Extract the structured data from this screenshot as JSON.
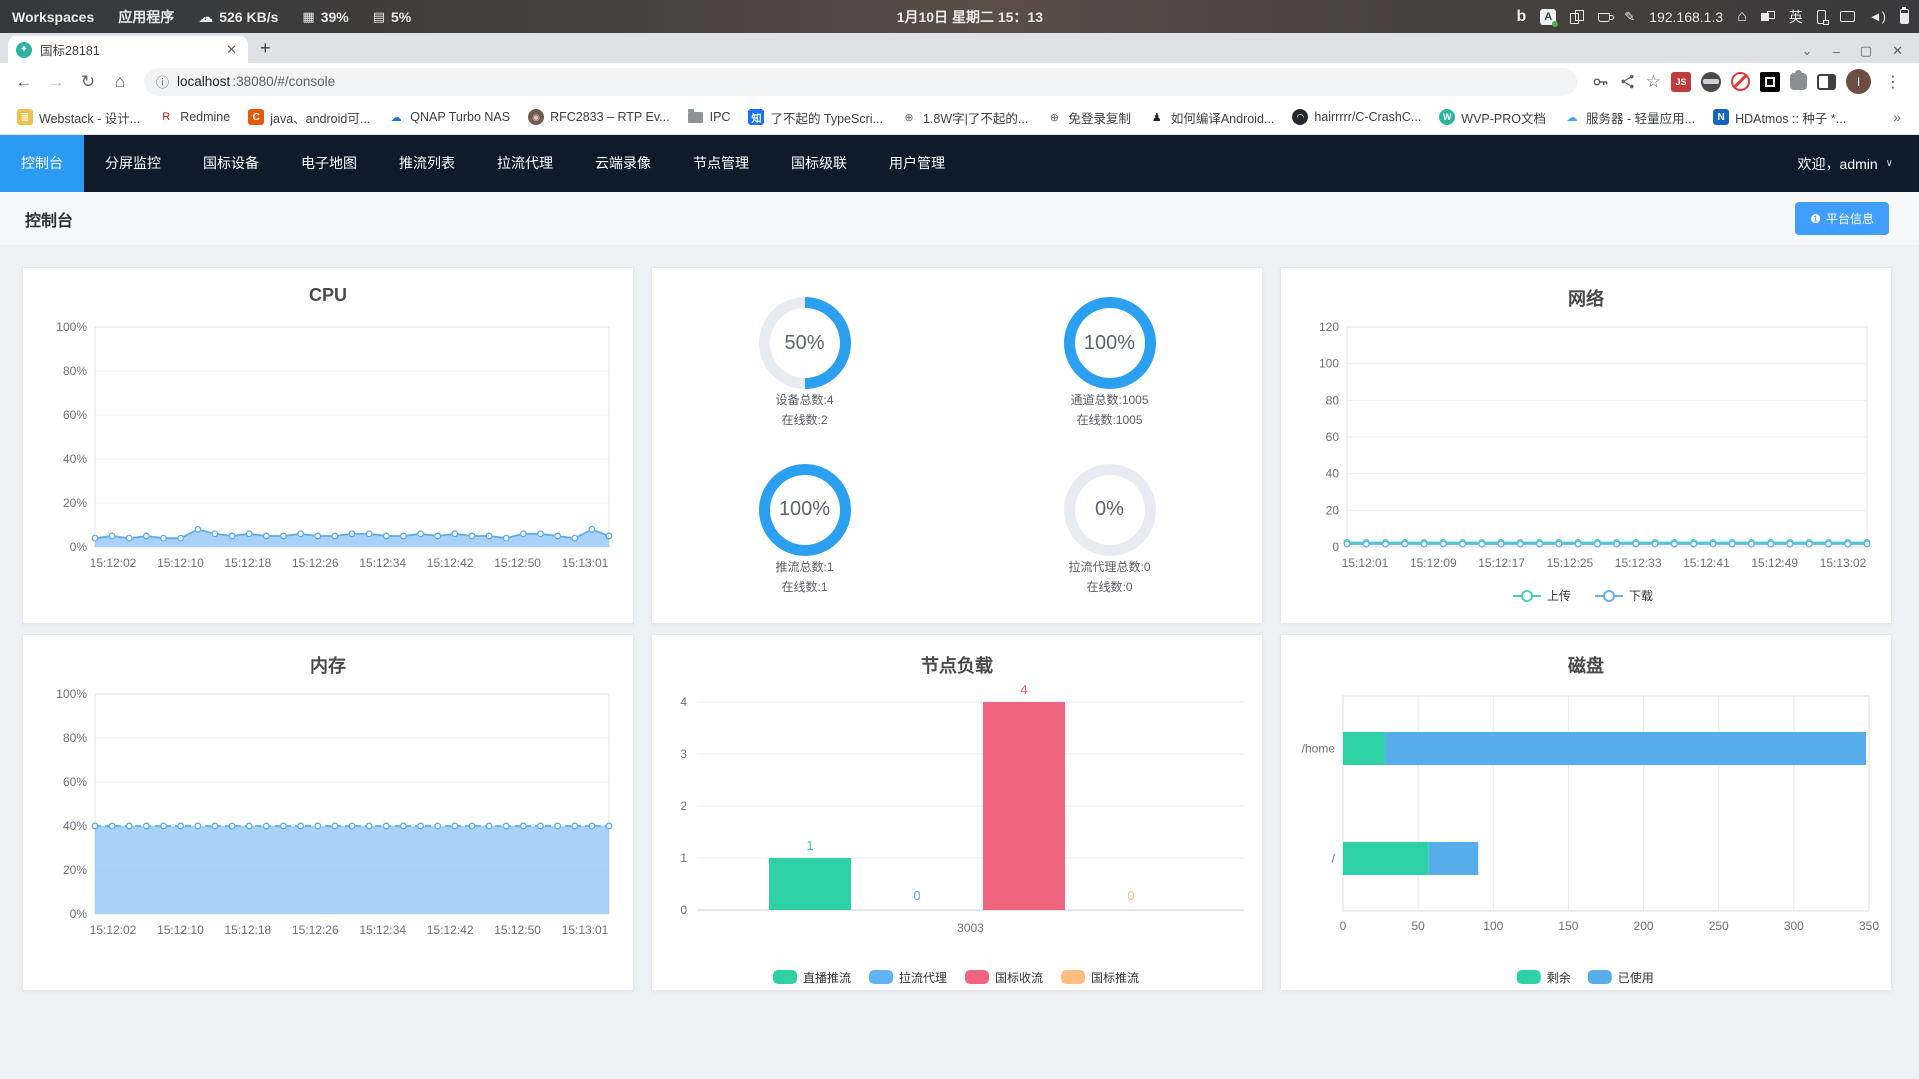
{
  "system_bar": {
    "workspaces": "Workspaces",
    "applications": "应用程序",
    "net_speed": "526 KB/s",
    "cpu_percent": "39%",
    "mem_percent": "5%",
    "datetime": "1月10日 星期二  15：13",
    "ip": "192.168.1.3",
    "input_method": "英",
    "bing_glyph": "b"
  },
  "browser": {
    "tab_title": "国标28181",
    "url_host": "localhost",
    "url_rest": ":38080/#/console",
    "info_glyph": "ⓘ",
    "profile_initial": "I"
  },
  "bookmarks": [
    {
      "label": "Webstack - 设计...",
      "icon": {
        "type": "square",
        "bg": "#f0c24b",
        "glyph": "≣",
        "fg": "#fff"
      }
    },
    {
      "label": "Redmine",
      "icon": {
        "type": "glyph",
        "glyph": "R",
        "fg": "#b32024"
      }
    },
    {
      "label": "java、android可...",
      "icon": {
        "type": "square",
        "bg": "#e8590c",
        "glyph": "C",
        "fg": "#fff"
      }
    },
    {
      "label": "QNAP Turbo NAS",
      "icon": {
        "type": "glyph",
        "glyph": "☁",
        "fg": "#1976d2"
      }
    },
    {
      "label": "RFC2833 – RTP Ev...",
      "icon": {
        "type": "circle",
        "bg": "#6d5b4f",
        "glyph": "◉",
        "fg": "#d7ccc8"
      }
    },
    {
      "label": "IPC",
      "icon": {
        "type": "folder"
      }
    },
    {
      "label": "了不起的 TypeScri...",
      "icon": {
        "type": "square",
        "bg": "#1772f6",
        "glyph": "知",
        "fg": "#fff"
      }
    },
    {
      "label": "1.8W字|了不起的...",
      "icon": {
        "type": "glyph",
        "glyph": "⊕",
        "fg": "#5d666d"
      }
    },
    {
      "label": "免登录复制",
      "icon": {
        "type": "glyph",
        "glyph": "⊕",
        "fg": "#5d666d"
      }
    },
    {
      "label": "如何编译Android...",
      "icon": {
        "type": "glyph",
        "glyph": "♟",
        "fg": "#222"
      }
    },
    {
      "label": "hairrrrr/C-CrashC...",
      "icon": {
        "type": "circle",
        "bg": "#24292e",
        "glyph": "◠",
        "fg": "#fff"
      }
    },
    {
      "label": "WVP-PRO文档",
      "icon": {
        "type": "circle",
        "bg": "#2ab5a0",
        "glyph": "W",
        "fg": "#fff"
      }
    },
    {
      "label": "服务器 - 轻量应用...",
      "icon": {
        "type": "glyph",
        "glyph": "☁",
        "fg": "#42a5f5"
      }
    },
    {
      "label": "HDAtmos :: 种子 *...",
      "icon": {
        "type": "square",
        "bg": "#1565c0",
        "glyph": "N",
        "fg": "#fff"
      }
    }
  ],
  "bookmarks_overflow": "»",
  "nav": {
    "items": [
      "控制台",
      "分屏监控",
      "国标设备",
      "电子地图",
      "推流列表",
      "拉流代理",
      "云端录像",
      "节点管理",
      "国标级联",
      "用户管理"
    ],
    "active_index": 0,
    "welcome": "欢迎，admin"
  },
  "page": {
    "title": "控制台",
    "platform_button": "平台信息"
  },
  "colors": {
    "accent_blue": "#409eff",
    "nav_active": "#2b9af3",
    "ring_blue": "#2b9ff0",
    "ring_track": "#e8ecf2",
    "area_line": "#5dabf0",
    "area_fill": "rgba(140,195,245,0.75)"
  },
  "rings": [
    {
      "percent": 50,
      "text": "50%",
      "line1": "设备总数:4",
      "line2": "在线数:2"
    },
    {
      "percent": 100,
      "text": "100%",
      "line1": "通道总数:1005",
      "line2": "在线数:1005"
    },
    {
      "percent": 100,
      "text": "100%",
      "line1": "推流总数:1",
      "line2": "在线数:1"
    },
    {
      "percent": 0,
      "text": "0%",
      "line1": "拉流代理总数:0",
      "line2": "在线数:0"
    }
  ],
  "chart_data": [
    {
      "type": "area",
      "title": "CPU",
      "ylim": [
        0,
        100
      ],
      "ytick_labels": [
        "0%",
        "20%",
        "40%",
        "60%",
        "80%",
        "100%"
      ],
      "yticks": [
        0,
        20,
        40,
        60,
        80,
        100
      ],
      "x_labels": [
        "15:12:02",
        "15:12:10",
        "15:12:18",
        "15:12:26",
        "15:12:34",
        "15:12:42",
        "15:12:50",
        "15:13:01"
      ],
      "values": [
        4,
        5,
        4,
        5,
        4,
        4,
        8,
        6,
        5,
        6,
        5,
        5,
        6,
        5,
        5,
        6,
        6,
        5,
        5,
        6,
        5,
        6,
        5,
        5,
        4,
        6,
        6,
        5,
        4,
        8,
        5
      ]
    },
    {
      "type": "line",
      "title": "网络",
      "ylim": [
        0,
        120
      ],
      "ytick_labels": [
        "0",
        "20",
        "40",
        "60",
        "80",
        "100",
        "120"
      ],
      "yticks": [
        0,
        20,
        40,
        60,
        80,
        100,
        120
      ],
      "x_labels": [
        "15:12:01",
        "15:12:09",
        "15:12:17",
        "15:12:25",
        "15:12:33",
        "15:12:41",
        "15:12:49",
        "15:13:02"
      ],
      "legend_position": "bottom",
      "series": [
        {
          "name": "上传",
          "color": "#45d4b2",
          "values": [
            0,
            0,
            0,
            0,
            0,
            0,
            0,
            0,
            0,
            0,
            0,
            0,
            0,
            0,
            0,
            0,
            0,
            0,
            0,
            0,
            0,
            0,
            0,
            0,
            0,
            0,
            0,
            0
          ]
        },
        {
          "name": "下载",
          "color": "#62b3f2",
          "values": [
            0,
            0,
            0,
            0,
            0,
            0,
            0,
            0,
            0,
            0,
            0,
            0,
            0,
            0,
            0,
            0,
            0,
            0,
            0,
            0,
            0,
            0,
            0,
            0,
            0,
            0,
            0,
            0
          ]
        }
      ]
    },
    {
      "type": "area",
      "title": "内存",
      "ylim": [
        0,
        100
      ],
      "dashed": true,
      "ytick_labels": [
        "0%",
        "20%",
        "40%",
        "60%",
        "80%",
        "100%"
      ],
      "yticks": [
        0,
        20,
        40,
        60,
        80,
        100
      ],
      "x_labels": [
        "15:12:02",
        "15:12:10",
        "15:12:18",
        "15:12:26",
        "15:12:34",
        "15:12:42",
        "15:12:50",
        "15:13:01"
      ],
      "values": [
        40,
        40,
        40,
        40,
        40,
        40,
        40,
        40,
        40,
        40,
        40,
        40,
        40,
        40,
        40,
        40,
        40,
        40,
        40,
        40,
        40,
        40,
        40,
        40,
        40,
        40,
        40,
        40,
        40,
        40,
        40
      ]
    },
    {
      "type": "bar",
      "title": "节点负载",
      "category": "3003",
      "ylim": [
        0,
        4
      ],
      "yticks": [
        0,
        1,
        2,
        3,
        4
      ],
      "legend_position": "bottom",
      "series": [
        {
          "name": "直播推流",
          "color": "#2ed0a5",
          "value": 1
        },
        {
          "name": "拉流代理",
          "color": "#62b3f2",
          "value": 0
        },
        {
          "name": "国标收流",
          "color": "#f0647f",
          "value": 4
        },
        {
          "name": "国标推流",
          "color": "#ffbe7d",
          "value": 0
        }
      ]
    },
    {
      "type": "hbar",
      "title": "磁盘",
      "categories": [
        "/home",
        "/"
      ],
      "xticks": [
        0,
        50,
        100,
        150,
        200,
        250,
        300,
        350
      ],
      "xlim": [
        0,
        350
      ],
      "legend_position": "bottom",
      "series": [
        {
          "name": "剩余",
          "color": "#2ed0a5",
          "values": [
            28,
            57
          ]
        },
        {
          "name": "已使用",
          "color": "#57ade9",
          "values": [
            320,
            33
          ]
        }
      ]
    }
  ]
}
